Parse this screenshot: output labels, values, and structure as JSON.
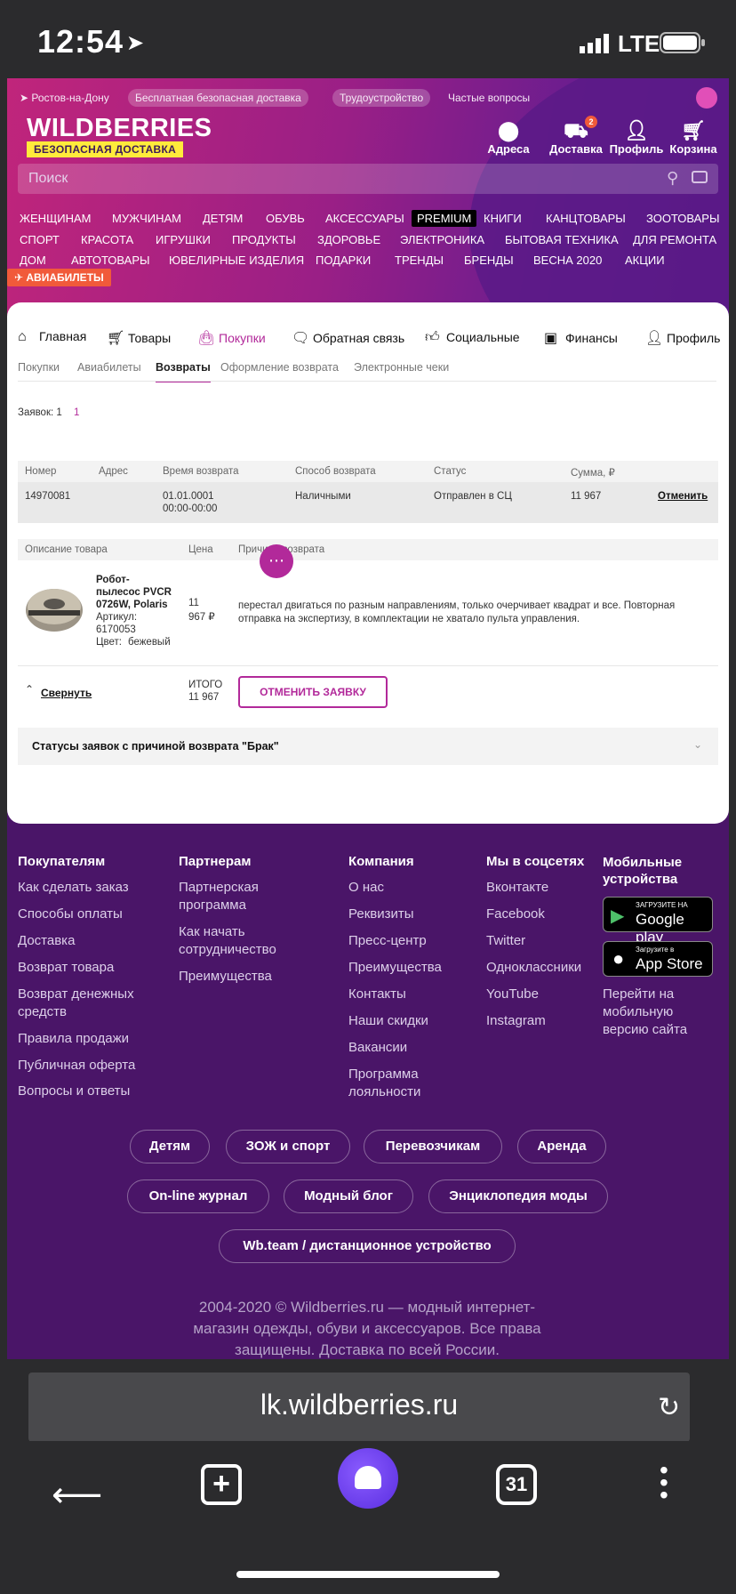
{
  "status_bar": {
    "time": "12:54",
    "network": "LTE"
  },
  "header": {
    "city": "Ростов-на-Дону",
    "top_links": [
      "Бесплатная безопасная доставка",
      "Трудоустройство",
      "Частые вопросы"
    ],
    "logo": "WILDBERRIES",
    "logo_tagline": "БЕЗОПАСНАЯ ДОСТАВКА",
    "icons": [
      {
        "label": "Адреса",
        "icon": "location-icon"
      },
      {
        "label": "Доставка",
        "icon": "delivery-icon",
        "badge": "2"
      },
      {
        "label": "Профиль",
        "icon": "profile-icon"
      },
      {
        "label": "Корзина",
        "icon": "cart-icon"
      }
    ],
    "search_placeholder": "Поиск",
    "categories_row1": [
      "ЖЕНЩИНАМ",
      "МУЖЧИНАМ",
      "ДЕТЯМ",
      "ОБУВЬ",
      "АКСЕССУАРЫ",
      "PREMIUM",
      "КНИГИ",
      "КАНЦТОВАРЫ",
      "ЗООТОВАРЫ"
    ],
    "categories_row2": [
      "СПОРТ",
      "КРАСОТА",
      "ИГРУШКИ",
      "ПРОДУКТЫ",
      "ЗДОРОВЬЕ",
      "ЭЛЕКТРОНИКА",
      "БЫТОВАЯ ТЕХНИКА",
      "ДЛЯ РЕМОНТА"
    ],
    "categories_row3": [
      "ДОМ",
      "АВТОТОВАРЫ",
      "ЮВЕЛИРНЫЕ ИЗДЕЛИЯ",
      "ПОДАРКИ",
      "ТРЕНДЫ",
      "БРЕНДЫ",
      "ВЕСНА 2020",
      "АКЦИИ"
    ],
    "avia_badge": "АВИАБИЛЕТЫ"
  },
  "account_nav": [
    "Главная",
    "Товары",
    "Покупки",
    "Обратная связь",
    "Социальные",
    "Финансы",
    "Профиль"
  ],
  "account_nav_active": "Покупки",
  "sub_tabs": [
    "Покупки",
    "Авиабилеты",
    "Возвраты",
    "Оформление возврата",
    "Электронные чеки"
  ],
  "sub_tab_active": "Возвраты",
  "requests": {
    "label": "Заявок: 1",
    "page": "1"
  },
  "returns_table": {
    "headers": [
      "Номер",
      "Адрес",
      "Время возврата",
      "Способ возврата",
      "Статус",
      "Сумма, ₽"
    ],
    "row": {
      "number": "14970081",
      "address": "",
      "time_line1": "01.01.0001",
      "time_line2": "00:00-00:00",
      "method": "Наличными",
      "status": "Отправлен в СЦ",
      "sum": "11 967",
      "action": "Отменить"
    }
  },
  "product_table": {
    "headers": [
      "Описание товара",
      "Цена",
      "Причина возврата"
    ],
    "item": {
      "name_line1": "Робот-",
      "name_line2": "пылесос PVCR",
      "name_line3": "0726W, Polaris",
      "article_label": "Артикул:",
      "article": "6170053",
      "color_label": "Цвет:",
      "color": "бежевый",
      "price_line1": "11",
      "price_line2": "967 ₽",
      "reason": "перестал двигаться по разным направлениям, только очерчивает квадрат и все. Повторная отправка на экспертизу, в комплектации не хватало пульта управления."
    }
  },
  "collapse_label": "Свернуть",
  "total": {
    "label": "ИТОГО",
    "value": "11 967"
  },
  "cancel_request_button": "ОТМЕНИТЬ ЗАЯВКУ",
  "accordion_title": "Статусы заявок с причиной возврата \"Брак\"",
  "footer": {
    "col1": {
      "title": "Покупателям",
      "links": [
        "Как сделать заказ",
        "Способы оплаты",
        "Доставка",
        "Возврат товара",
        "Возврат денежных средств",
        "Правила продажи",
        "Публичная оферта",
        "Вопросы и ответы"
      ]
    },
    "col2": {
      "title": "Партнерам",
      "links": [
        "Партнерская программа",
        "Как начать сотрудничество",
        "Преимущества"
      ]
    },
    "col3": {
      "title": "Компания",
      "links": [
        "О нас",
        "Реквизиты",
        "Пресс-центр",
        "Преимущества",
        "Контакты",
        "Наши скидки",
        "Вакансии",
        "Программа лояльности"
      ]
    },
    "col4": {
      "title": "Мы в соцсетях",
      "links": [
        "Вконтакте",
        "Facebook",
        "Twitter",
        "Одноклассники",
        "YouTube",
        "Instagram"
      ]
    },
    "col5": {
      "title": "Мобильные устройства",
      "google_small": "ЗАГРУЗИТЕ НА",
      "google_big": "Google play",
      "apple_small": "Загрузите в",
      "apple_big": "App Store",
      "mobile_link": "Перейти на мобильную версию сайта"
    },
    "pills_row1": [
      "Детям",
      "ЗОЖ и спорт",
      "Перевозчикам",
      "Аренда"
    ],
    "pills_row2": [
      "On-line журнал",
      "Модный блог",
      "Энциклопедия моды"
    ],
    "pills_row3": [
      "Wb.team / дистанционное устройство"
    ],
    "copyright": "2004-2020 © Wildberries.ru — модный интернет-магазин одежды, обуви и аксессуаров. Все права защищены. Доставка по всей России."
  },
  "browser": {
    "url": "lk.wildberries.ru",
    "tabs_count": "31"
  }
}
